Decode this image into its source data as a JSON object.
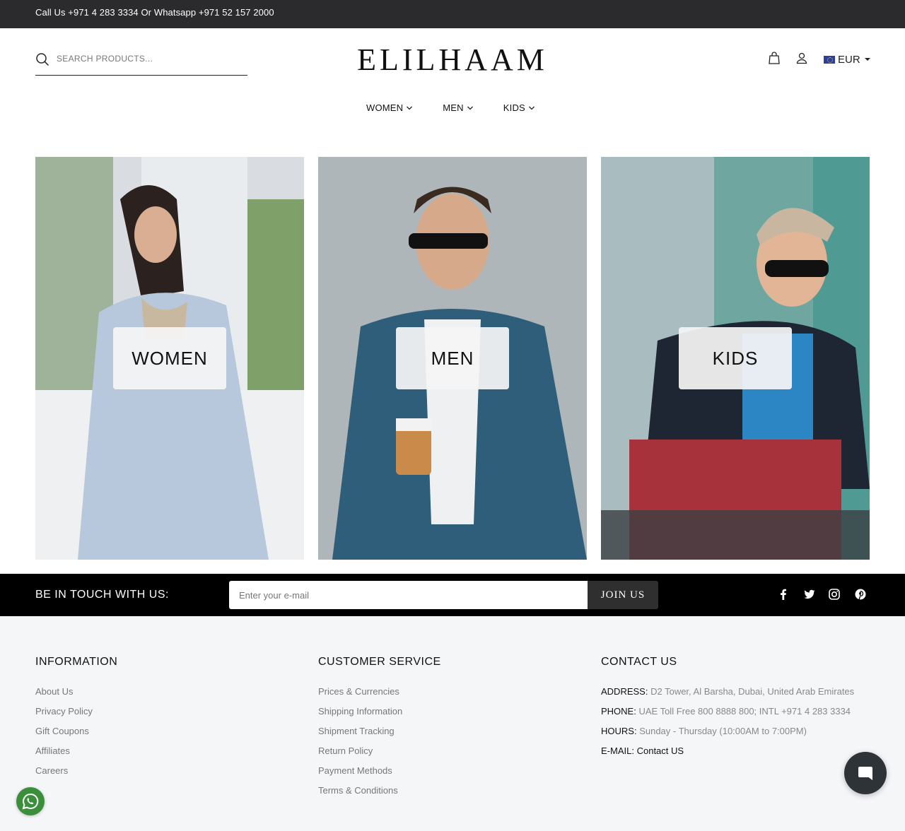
{
  "topbar": {
    "text": "Call Us +971 4 283 3334 Or Whatsapp +971 52 157 2000"
  },
  "header": {
    "search_placeholder": "SEARCH PRODUCTS...",
    "logo": "ELILHAAM",
    "currency": "EUR",
    "icons": {
      "search": "search-icon",
      "cart": "shopping-bag-icon",
      "account": "user-icon",
      "flag": "eu-flag-icon"
    }
  },
  "nav": {
    "items": [
      {
        "label": "WOMEN"
      },
      {
        "label": "MEN"
      },
      {
        "label": "KIDS"
      }
    ]
  },
  "categories": [
    {
      "label": "WOMEN",
      "image": "photo of woman in pale blue dress"
    },
    {
      "label": "MEN",
      "image": "photo of man in blue blazer holding coffee"
    },
    {
      "label": "KIDS",
      "image": "photo of boy in leather jacket and sunglasses"
    }
  ],
  "newsletter": {
    "title": "BE IN TOUCH WITH US:",
    "placeholder": "Enter your e-mail",
    "button": "JOIN US",
    "social_icons": [
      "facebook-icon",
      "twitter-icon",
      "instagram-icon",
      "pinterest-icon"
    ]
  },
  "footer": {
    "information": {
      "title": "INFORMATION",
      "links": [
        "About Us",
        "Privacy Policy",
        "Gift Coupons",
        "Affiliates",
        "Careers"
      ]
    },
    "customer_service": {
      "title": "CUSTOMER SERVICE",
      "links": [
        "Prices & Currencies",
        "Shipping Information",
        "Shipment Tracking",
        "Return Policy",
        "Payment Methods",
        "Terms & Conditions"
      ]
    },
    "contact": {
      "title": "CONTACT US",
      "address_label": "ADDRESS:",
      "address": "D2 Tower, Al Barsha, Dubai, United Arab Emirates",
      "phone_label": "PHONE:",
      "phone": "UAE Toll Free 800 8888 800; INTL +971 4 283 3334",
      "hours_label": "HOURS:",
      "hours": "Sunday - Thursday (10:00AM to 7:00PM)",
      "email_label": "E-MAIL:",
      "email_link": "Contact US"
    }
  },
  "widgets": {
    "chat": "chat-icon",
    "whatsapp": "whatsapp-icon"
  },
  "colors": {
    "topbar": "#2b2b2d",
    "newsletter_bg": "#000000",
    "footer_bg": "#f5f6f8",
    "join_button": "#2f2f2f",
    "chat_button": "#2e3338",
    "whatsapp": "#3b8f3b"
  }
}
